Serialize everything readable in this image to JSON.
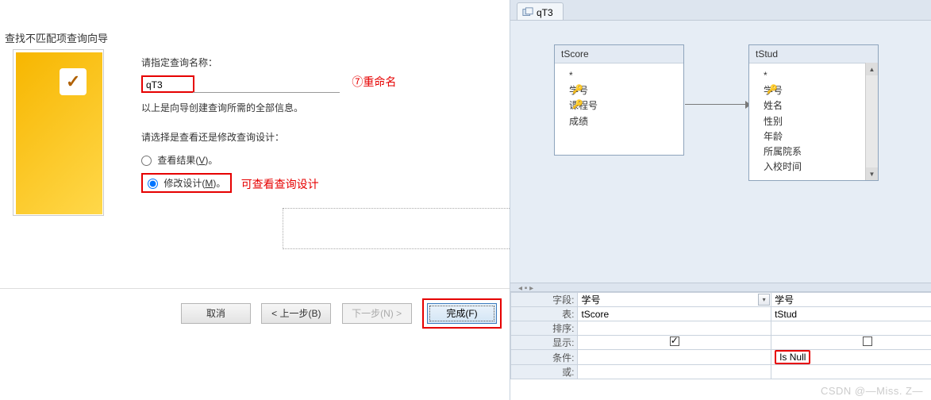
{
  "wizard": {
    "title": "查找不匹配项查询向导",
    "specify_label": "请指定查询名称：",
    "query_name": "qT3",
    "rename_annot": "⑦重命名",
    "info_line": "以上是向导创建查询所需的全部信息。",
    "choose_line": "请选择是查看还是修改查询设计：",
    "radio_view": "查看结果(",
    "radio_view_u": "V",
    "radio_view_end": ")。",
    "radio_modify": "修改设计(",
    "radio_modify_u": "M",
    "radio_modify_end": ")。",
    "design_annot": "可查看查询设计",
    "buttons": {
      "cancel": "取消",
      "back": "< 上一步(B)",
      "next": "下一步(N) >",
      "finish": "完成(F)"
    }
  },
  "designer": {
    "tab_label": "qT3",
    "table1": {
      "title": "tScore",
      "star": "*",
      "fields": [
        "学号",
        "课程号",
        "成绩"
      ]
    },
    "table2": {
      "title": "tStud",
      "star": "*",
      "fields": [
        "学号",
        "姓名",
        "性别",
        "年龄",
        "所属院系",
        "入校时间"
      ]
    },
    "grid": {
      "row_labels": {
        "field": "字段:",
        "table": "表:",
        "sort": "排序:",
        "show": "显示:",
        "criteria": "条件:",
        "or": "或:"
      },
      "col1": {
        "field": "学号",
        "table": "tScore",
        "show": true,
        "criteria": ""
      },
      "col2": {
        "field": "学号",
        "table": "tStud",
        "show": false,
        "criteria": "Is Null"
      },
      "col3": {
        "field": "",
        "table": "",
        "show": false,
        "criteria": ""
      }
    }
  },
  "watermark": "CSDN @—Miss. Z—"
}
